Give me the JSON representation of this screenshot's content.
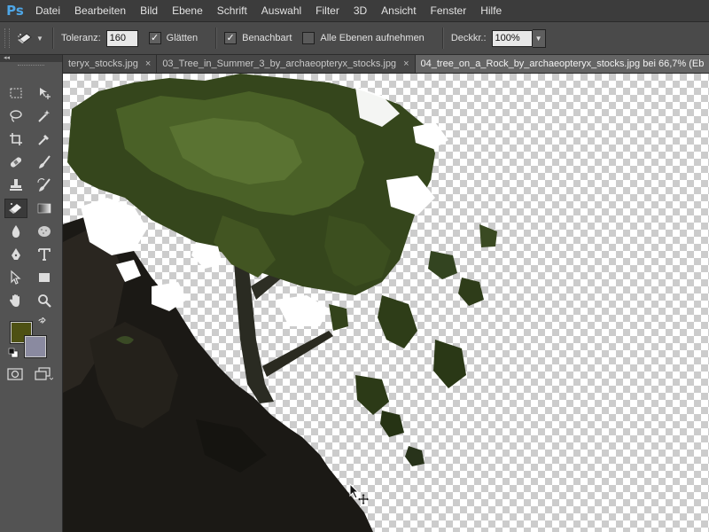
{
  "app": {
    "logo": "Ps"
  },
  "menu": {
    "items": [
      "Datei",
      "Bearbeiten",
      "Bild",
      "Ebene",
      "Schrift",
      "Auswahl",
      "Filter",
      "3D",
      "Ansicht",
      "Fenster",
      "Hilfe"
    ]
  },
  "options": {
    "tolerance_label": "Toleranz:",
    "tolerance_value": "160",
    "smooth_label": "Glätten",
    "smooth_checked": true,
    "contiguous_label": "Benachbart",
    "contiguous_checked": true,
    "all_layers_label": "Alle Ebenen aufnehmen",
    "all_layers_checked": false,
    "opacity_label": "Deckkr.:",
    "opacity_value": "100%"
  },
  "toolpanel": {
    "collapse_label": "◂◂",
    "foreground_color": "#4e5113",
    "background_color": "#8a8aa0"
  },
  "tabs": [
    {
      "label": "teryx_stocks.jpg",
      "active": false,
      "close": "×"
    },
    {
      "label": "03_Tree_in_Summer_3_by_archaeopteryx_stocks.jpg",
      "active": false,
      "close": "×"
    },
    {
      "label": "04_tree_on_a_Rock_by_archaeopteryx_stocks.jpg bei 66,7% (Eb",
      "active": true,
      "close": ""
    }
  ],
  "icons": {
    "tool_preset": "background-eraser-icon",
    "active_tool": "background-eraser-icon",
    "cursor": "move-crosshair-icon"
  }
}
